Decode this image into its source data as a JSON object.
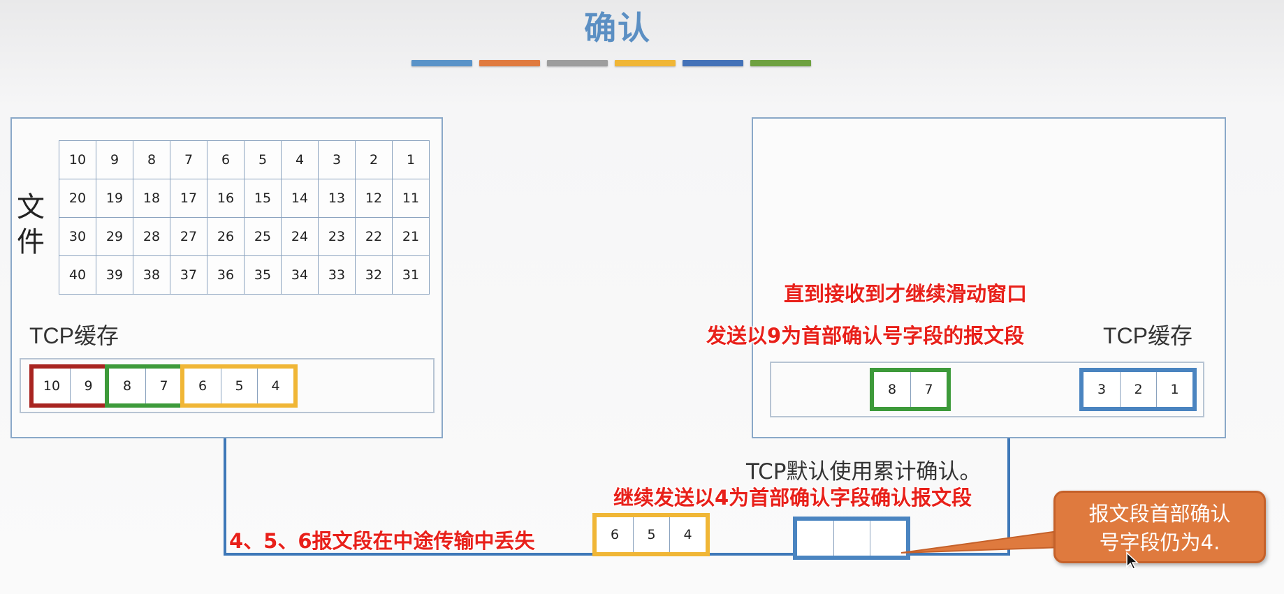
{
  "title": "确认",
  "color_bar": [
    "#5a93c8",
    "#e07a3e",
    "#9d9d9d",
    "#f0b636",
    "#4472b8",
    "#6ea140"
  ],
  "sender": {
    "file_label": "文件",
    "file_grid": [
      [
        "10",
        "9",
        "8",
        "7",
        "6",
        "5",
        "4",
        "3",
        "2",
        "1"
      ],
      [
        "20",
        "19",
        "18",
        "17",
        "16",
        "15",
        "14",
        "13",
        "12",
        "11"
      ],
      [
        "30",
        "29",
        "28",
        "27",
        "26",
        "25",
        "24",
        "23",
        "22",
        "21"
      ],
      [
        "40",
        "39",
        "38",
        "37",
        "36",
        "35",
        "34",
        "33",
        "32",
        "31"
      ]
    ],
    "cache_label": "TCP缓存",
    "cache_groups": [
      {
        "color": "#a82420",
        "cells": [
          "10",
          "9"
        ]
      },
      {
        "color": "#3d9a3a",
        "cells": [
          "8",
          "7"
        ]
      },
      {
        "color": "#f0b636",
        "cells": [
          "6",
          "5",
          "4"
        ]
      }
    ]
  },
  "receiver": {
    "cache_label": "TCP缓存",
    "groups": [
      {
        "color": "#3d9a3a",
        "cells": [
          "8",
          "7"
        ]
      },
      {
        "color": "#4a84c0",
        "cells": [
          "3",
          "2",
          "1"
        ]
      }
    ]
  },
  "annotations": {
    "until_received": "直到接收到才继续滑动窗口",
    "send_ack9": "发送以9为首部确认号字段的报文段",
    "cumulative": "TCP默认使用累计确认。",
    "continue_ack4": "继续发送以4为首部确认字段确认报文段",
    "lost": "4、5、6报文段在中途传输中丢失"
  },
  "in_transit": {
    "data_segment": {
      "color": "#f0b636",
      "cells": [
        "6",
        "5",
        "4"
      ]
    },
    "ack_segment": {
      "color": "#4a84c0",
      "cells": [
        "",
        "",
        ""
      ]
    }
  },
  "callout": {
    "line1": "报文段首部确认",
    "line2": "号字段仍为4."
  }
}
